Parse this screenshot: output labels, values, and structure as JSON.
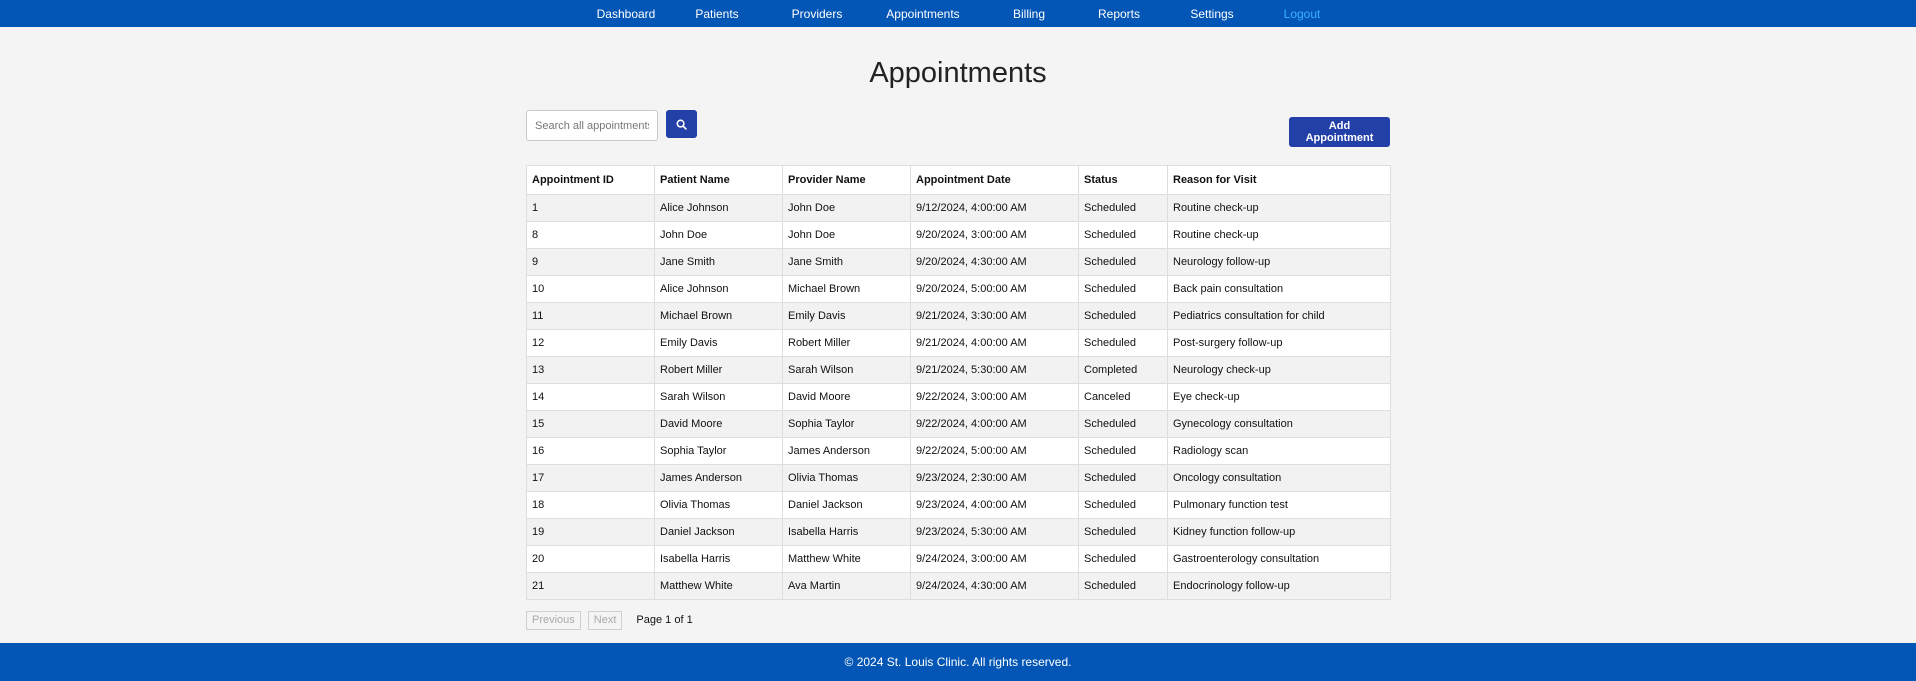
{
  "nav": {
    "items": [
      {
        "label": "Dashboard"
      },
      {
        "label": "Patients"
      },
      {
        "label": "Providers"
      },
      {
        "label": "Appointments"
      },
      {
        "label": "Billing"
      },
      {
        "label": "Reports"
      },
      {
        "label": "Settings"
      },
      {
        "label": "Logout"
      }
    ]
  },
  "page": {
    "title": "Appointments"
  },
  "toolbar": {
    "search_placeholder": "Search all appointments...",
    "search_icon": "search-icon",
    "add_label": "Add Appointment"
  },
  "table": {
    "columns": [
      "Appointment ID",
      "Patient Name",
      "Provider Name",
      "Appointment Date",
      "Status",
      "Reason for Visit"
    ],
    "rows": [
      [
        "1",
        "Alice Johnson",
        "John Doe",
        "9/12/2024, 4:00:00 AM",
        "Scheduled",
        "Routine check-up"
      ],
      [
        "8",
        "John Doe",
        "John Doe",
        "9/20/2024, 3:00:00 AM",
        "Scheduled",
        "Routine check-up"
      ],
      [
        "9",
        "Jane Smith",
        "Jane Smith",
        "9/20/2024, 4:30:00 AM",
        "Scheduled",
        "Neurology follow-up"
      ],
      [
        "10",
        "Alice Johnson",
        "Michael Brown",
        "9/20/2024, 5:00:00 AM",
        "Scheduled",
        "Back pain consultation"
      ],
      [
        "11",
        "Michael Brown",
        "Emily Davis",
        "9/21/2024, 3:30:00 AM",
        "Scheduled",
        "Pediatrics consultation for child"
      ],
      [
        "12",
        "Emily Davis",
        "Robert Miller",
        "9/21/2024, 4:00:00 AM",
        "Scheduled",
        "Post-surgery follow-up"
      ],
      [
        "13",
        "Robert Miller",
        "Sarah Wilson",
        "9/21/2024, 5:30:00 AM",
        "Completed",
        "Neurology check-up"
      ],
      [
        "14",
        "Sarah Wilson",
        "David Moore",
        "9/22/2024, 3:00:00 AM",
        "Canceled",
        "Eye check-up"
      ],
      [
        "15",
        "David Moore",
        "Sophia Taylor",
        "9/22/2024, 4:00:00 AM",
        "Scheduled",
        "Gynecology consultation"
      ],
      [
        "16",
        "Sophia Taylor",
        "James Anderson",
        "9/22/2024, 5:00:00 AM",
        "Scheduled",
        "Radiology scan"
      ],
      [
        "17",
        "James Anderson",
        "Olivia Thomas",
        "9/23/2024, 2:30:00 AM",
        "Scheduled",
        "Oncology consultation"
      ],
      [
        "18",
        "Olivia Thomas",
        "Daniel Jackson",
        "9/23/2024, 4:00:00 AM",
        "Scheduled",
        "Pulmonary function test"
      ],
      [
        "19",
        "Daniel Jackson",
        "Isabella Harris",
        "9/23/2024, 5:30:00 AM",
        "Scheduled",
        "Kidney function follow-up"
      ],
      [
        "20",
        "Isabella Harris",
        "Matthew White",
        "9/24/2024, 3:00:00 AM",
        "Scheduled",
        "Gastroenterology consultation"
      ],
      [
        "21",
        "Matthew White",
        "Ava Martin",
        "9/24/2024, 4:30:00 AM",
        "Scheduled",
        "Endocrinology follow-up"
      ]
    ]
  },
  "pagination": {
    "previous_label": "Previous",
    "next_label": "Next",
    "page_info": "Page 1 of 1"
  },
  "footer": {
    "text": "© 2024 St. Louis Clinic. All rights reserved."
  },
  "colors": {
    "nav_bg": "#0356b5",
    "accent_button": "#2340a8",
    "logout_link": "#3bb0ff",
    "page_bg": "#f4f4f4"
  }
}
